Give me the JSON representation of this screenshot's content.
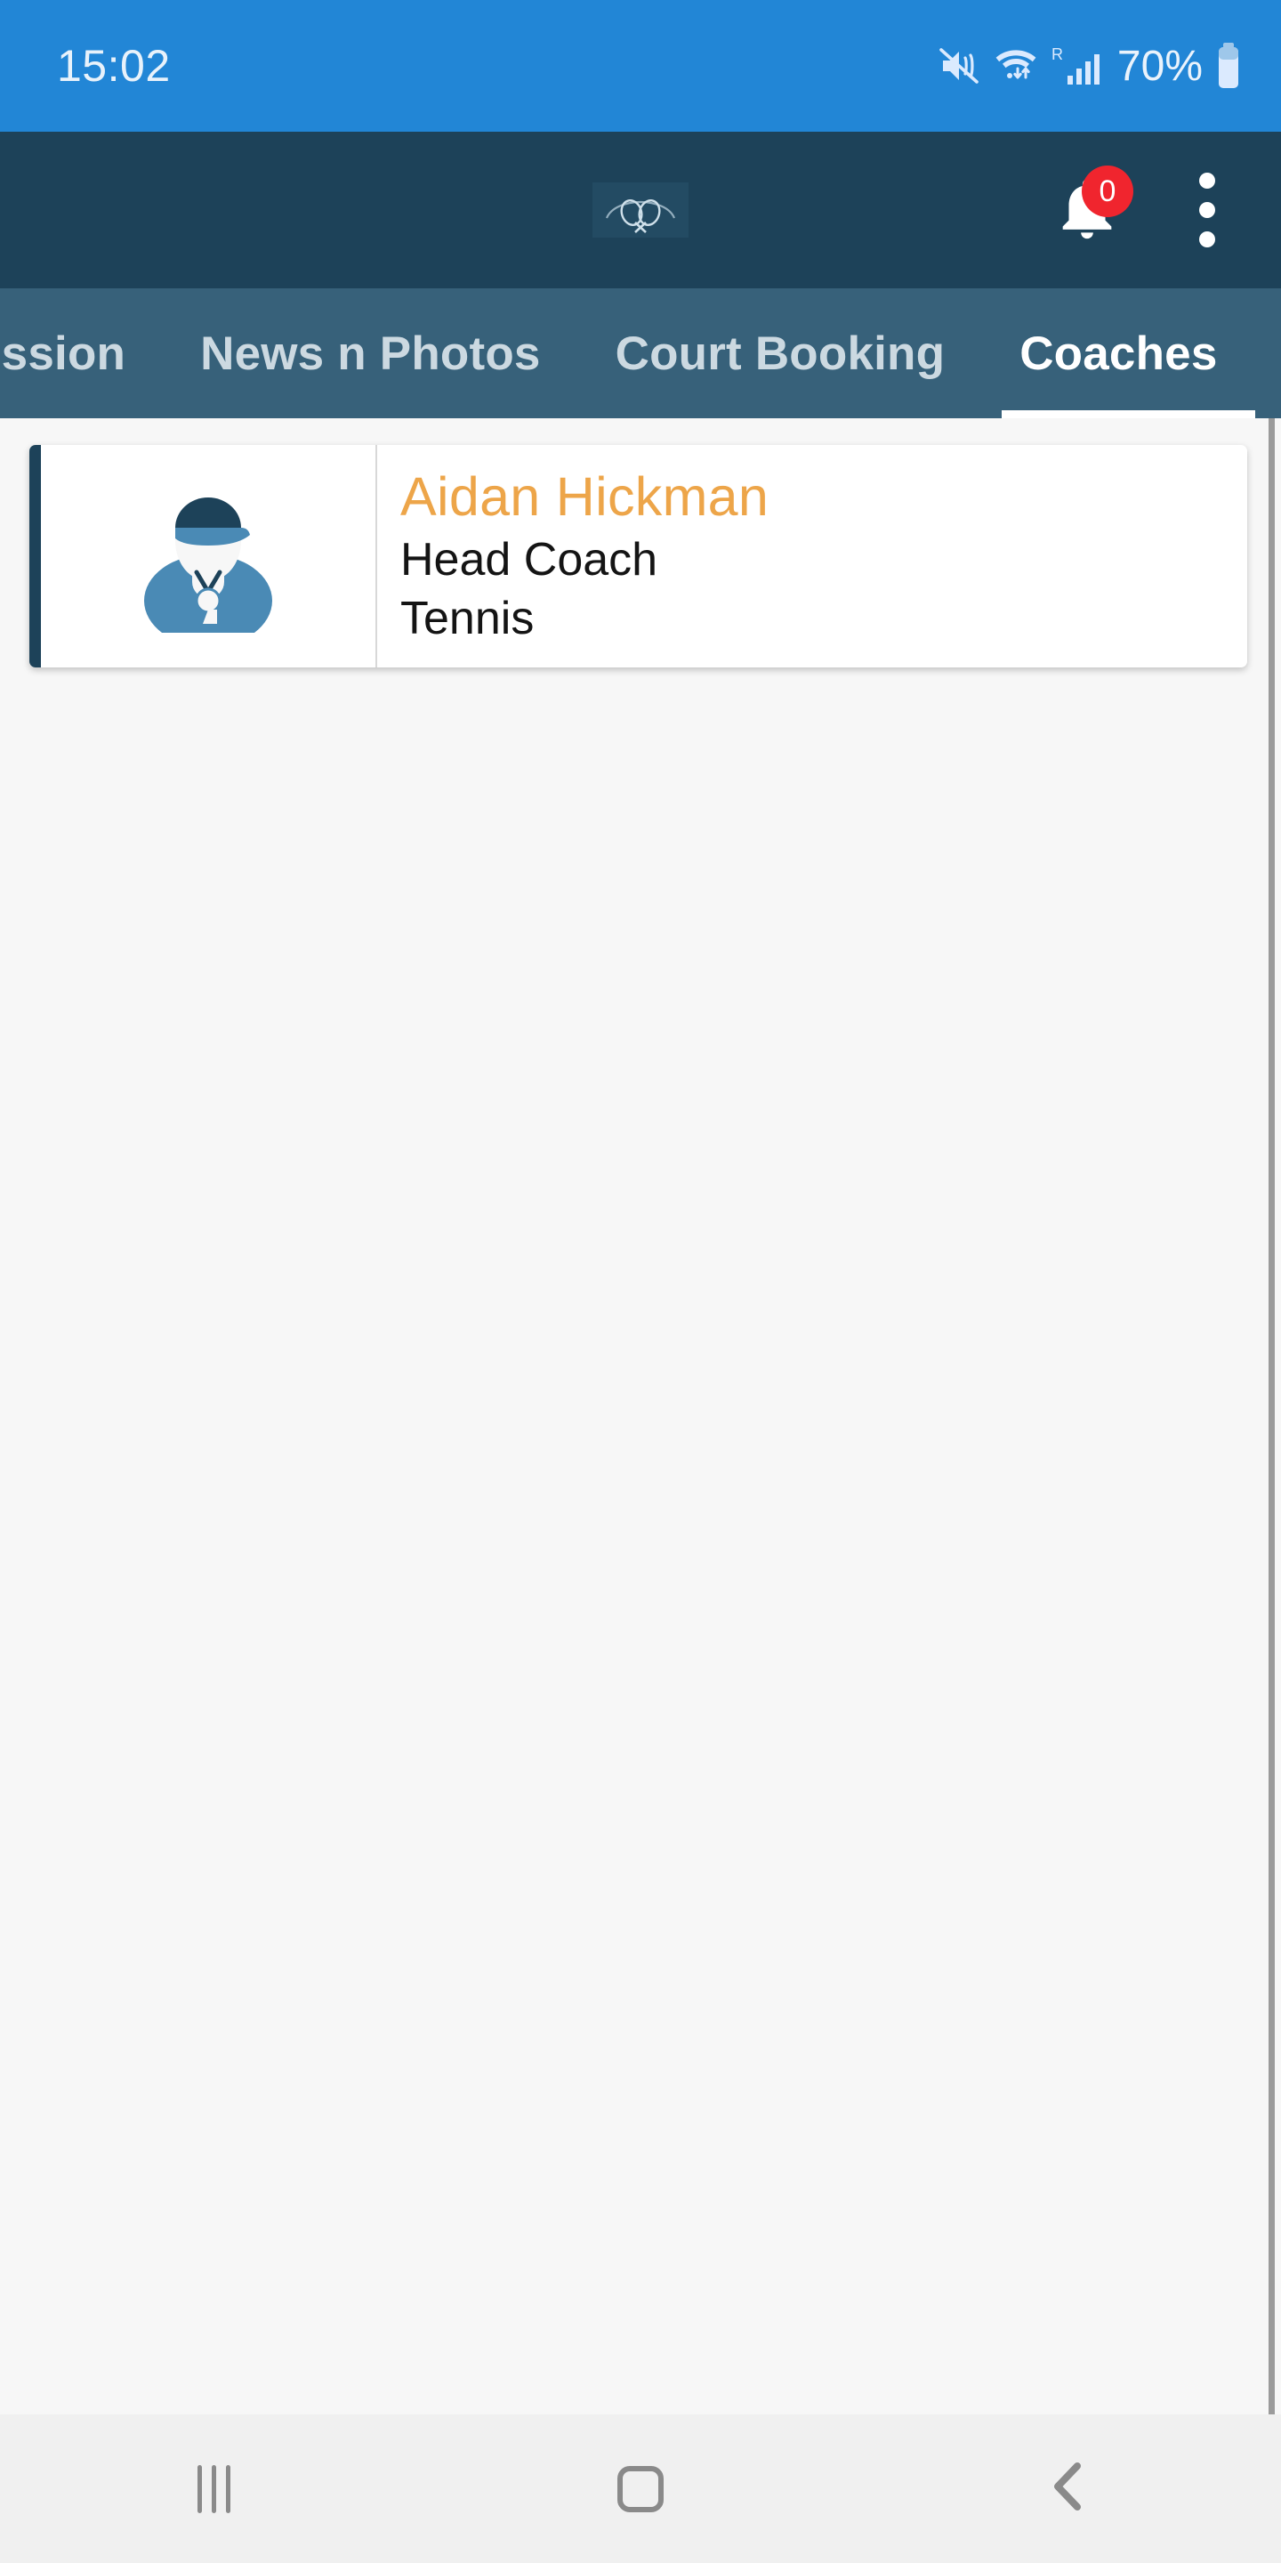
{
  "status_bar": {
    "time": "15:02",
    "battery_percent": "70%",
    "icons": [
      "mute-vibrate-icon",
      "wifi-icon",
      "roaming-signal-icon",
      "battery-icon"
    ]
  },
  "app_header": {
    "logo_alt": "tennis-club-logo",
    "notification": {
      "icon": "bell-icon",
      "badge_count": "0",
      "badge_color": "#f0252e"
    },
    "overflow_menu": "kebab-menu-icon",
    "background_color": "#1d4259"
  },
  "tabbar": {
    "background_color": "#37617a",
    "active_index": 3,
    "tabs": [
      {
        "label": "ession"
      },
      {
        "label": "News n Photos"
      },
      {
        "label": "Court Booking"
      },
      {
        "label": "Coaches"
      }
    ]
  },
  "content": {
    "background_color": "#f7f7f7",
    "coaches": [
      {
        "name": "Aidan Hickman",
        "role": "Head Coach",
        "sport": "Tennis",
        "avatar": "coach-avatar-icon",
        "name_color": "#eda549",
        "accent_color": "#1d4259"
      }
    ]
  },
  "navbar": {
    "buttons": [
      {
        "name": "recents-button",
        "icon": "recents-icon"
      },
      {
        "name": "home-button",
        "icon": "home-icon"
      },
      {
        "name": "back-button",
        "icon": "back-chevron-icon"
      }
    ]
  }
}
